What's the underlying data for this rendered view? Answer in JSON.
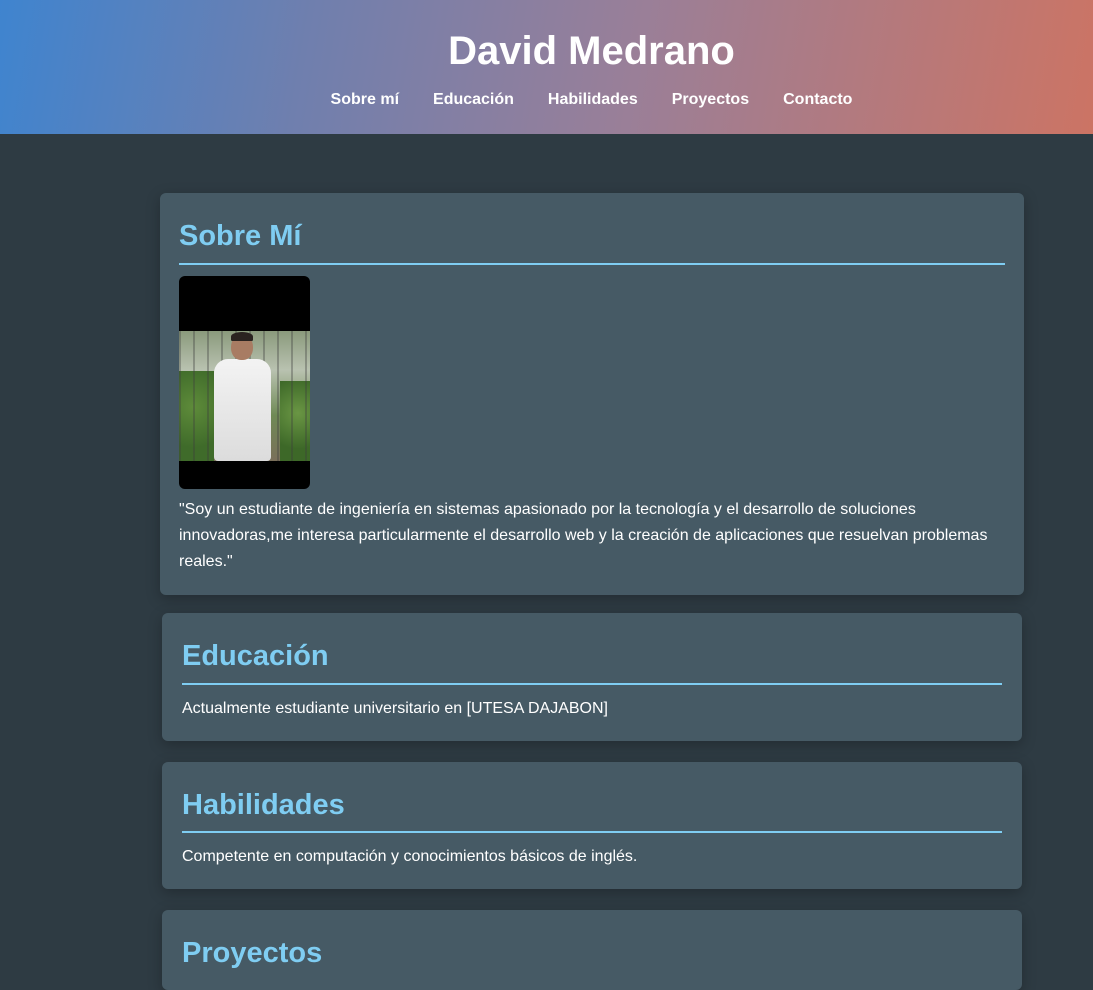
{
  "header": {
    "title": "David Medrano",
    "nav": [
      "Sobre mí",
      "Educación",
      "Habilidades",
      "Proyectos",
      "Contacto"
    ]
  },
  "about": {
    "heading": "Sobre Mí",
    "photo_icon": "profile-photo",
    "text": "\"Soy un estudiante de ingeniería en sistemas apasionado por la tecnología y el desarrollo de soluciones innovadoras,me interesa particularmente el desarrollo web y la creación de aplicaciones que resuelvan problemas reales.\""
  },
  "education": {
    "heading": "Educación",
    "text": "Actualmente estudiante universitario en [UTESA DAJABON]"
  },
  "skills": {
    "heading": "Habilidades",
    "text": "Competente en computación y conocimientos básicos de inglés."
  },
  "projects": {
    "heading": "Proyectos"
  },
  "colors": {
    "background": "#2e3b43",
    "card": "#465a65",
    "accent": "#7fcdf2",
    "header_gradient_start": "#3f84cf",
    "header_gradient_end": "#cc7464"
  }
}
